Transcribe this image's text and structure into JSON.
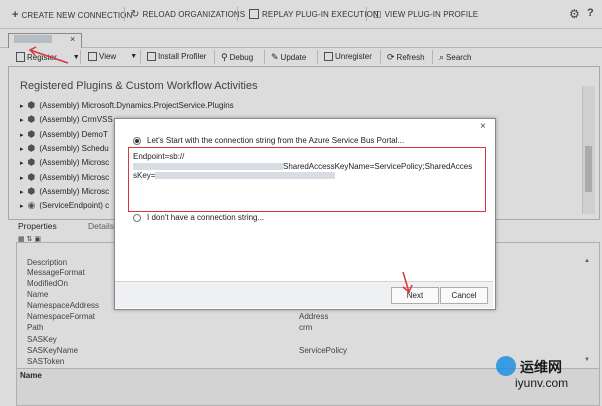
{
  "top_toolbar": {
    "create": "CREATE NEW CONNECTION",
    "reload": "RELOAD ORGANIZATIONS",
    "replay": "REPLAY PLUG-IN EXECUTION",
    "view_profile": "VIEW PLUG-IN PROFILE"
  },
  "tab": {
    "close": "×"
  },
  "toolbar": {
    "register": "Register",
    "view": "View",
    "install_profiler": "Install Profiler",
    "debug": "Debug",
    "update": "Update",
    "unregister": "Unregister",
    "refresh": "Refresh",
    "search": "Search"
  },
  "panel_title": "Registered Plugins & Custom Workflow Activities",
  "tree_items": [
    "(Assembly) Microsoft.Dynamics.ProjectService.Plugins",
    "(Assembly) CrmVSS",
    "(Assembly) DemoT",
    "(Assembly) Schedu",
    "(Assembly) Microsc",
    "(Assembly) Microsc",
    "(Assembly) Microsc",
    "(ServiceEndpoint) c"
  ],
  "prop_tabs": {
    "properties": "Properties",
    "details": "Details"
  },
  "properties": [
    {
      "name": "Description",
      "value": ""
    },
    {
      "name": "MessageFormat",
      "value": ""
    },
    {
      "name": "ModifiedOn",
      "value": ""
    },
    {
      "name": "Name",
      "value": ""
    },
    {
      "name": "NamespaceAddress",
      "value": ""
    },
    {
      "name": "NamespaceFormat",
      "value": "Address"
    },
    {
      "name": "Path",
      "value": "crm"
    },
    {
      "name": "SASKey",
      "value": ""
    },
    {
      "name": "SASKeyName",
      "value": "ServicePolicy"
    },
    {
      "name": "SASToken",
      "value": ""
    }
  ],
  "name_bar": "Name",
  "dialog": {
    "close": "×",
    "option1": "Let's Start with the connection string from the Azure Service Bus Portal...",
    "line1": "Endpoint=sb://",
    "line2_suffix": "SharedAccessKeyName=ServicePolicy;SharedAcces",
    "line3_prefix": "sKey=",
    "option2": "I don't have a connection string...",
    "next": "Next",
    "cancel": "Cancel"
  },
  "watermark": {
    "line1": "运维网",
    "line2": "iyunv.com"
  },
  "colors": {
    "highlight_red": "#d9363e"
  }
}
